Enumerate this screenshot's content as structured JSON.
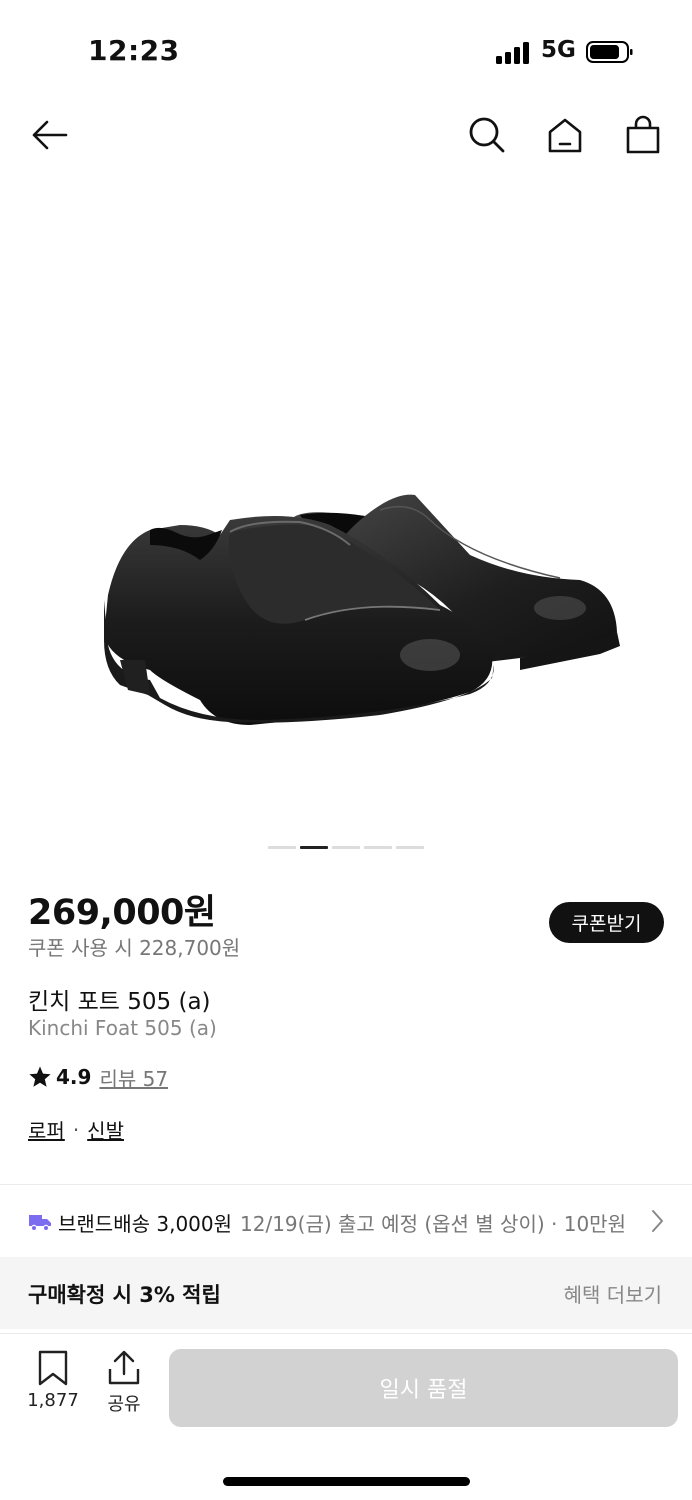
{
  "status_bar": {
    "time": "12:23",
    "network": "5G"
  },
  "nav": {
    "back_icon": "arrow-left-icon",
    "search_icon": "search-icon",
    "home_icon": "home-icon",
    "cart_icon": "shopping-bag-icon"
  },
  "gallery": {
    "image_count": 5,
    "active_index": 1
  },
  "product": {
    "price": "269,000원",
    "coupon_price": "쿠폰 사용 시 228,700원",
    "coupon_button": "쿠폰받기",
    "name_ko": "킨치 포트 505 (a)",
    "name_en": "Kinchi Foat 505 (a)",
    "rating": "4.9",
    "review_label": "리뷰 57",
    "category_1": "로퍼",
    "separator": "·",
    "category_2": "신발"
  },
  "shipping": {
    "label": "브랜드배송 3,000원",
    "detail": "12/19(금) 출고 예정 (옵션 별 상이) · 10만원"
  },
  "benefit": {
    "text": "구매확정 시 3% 적립",
    "more": "혜택 더보기"
  },
  "bottom_bar": {
    "bookmark_count": "1,877",
    "share_label": "공유",
    "soldout_label": "일시 품절"
  },
  "colors": {
    "primary": "#111111",
    "disabled_button": "#d2d2d2",
    "shipping_icon": "#7b6cf0"
  }
}
